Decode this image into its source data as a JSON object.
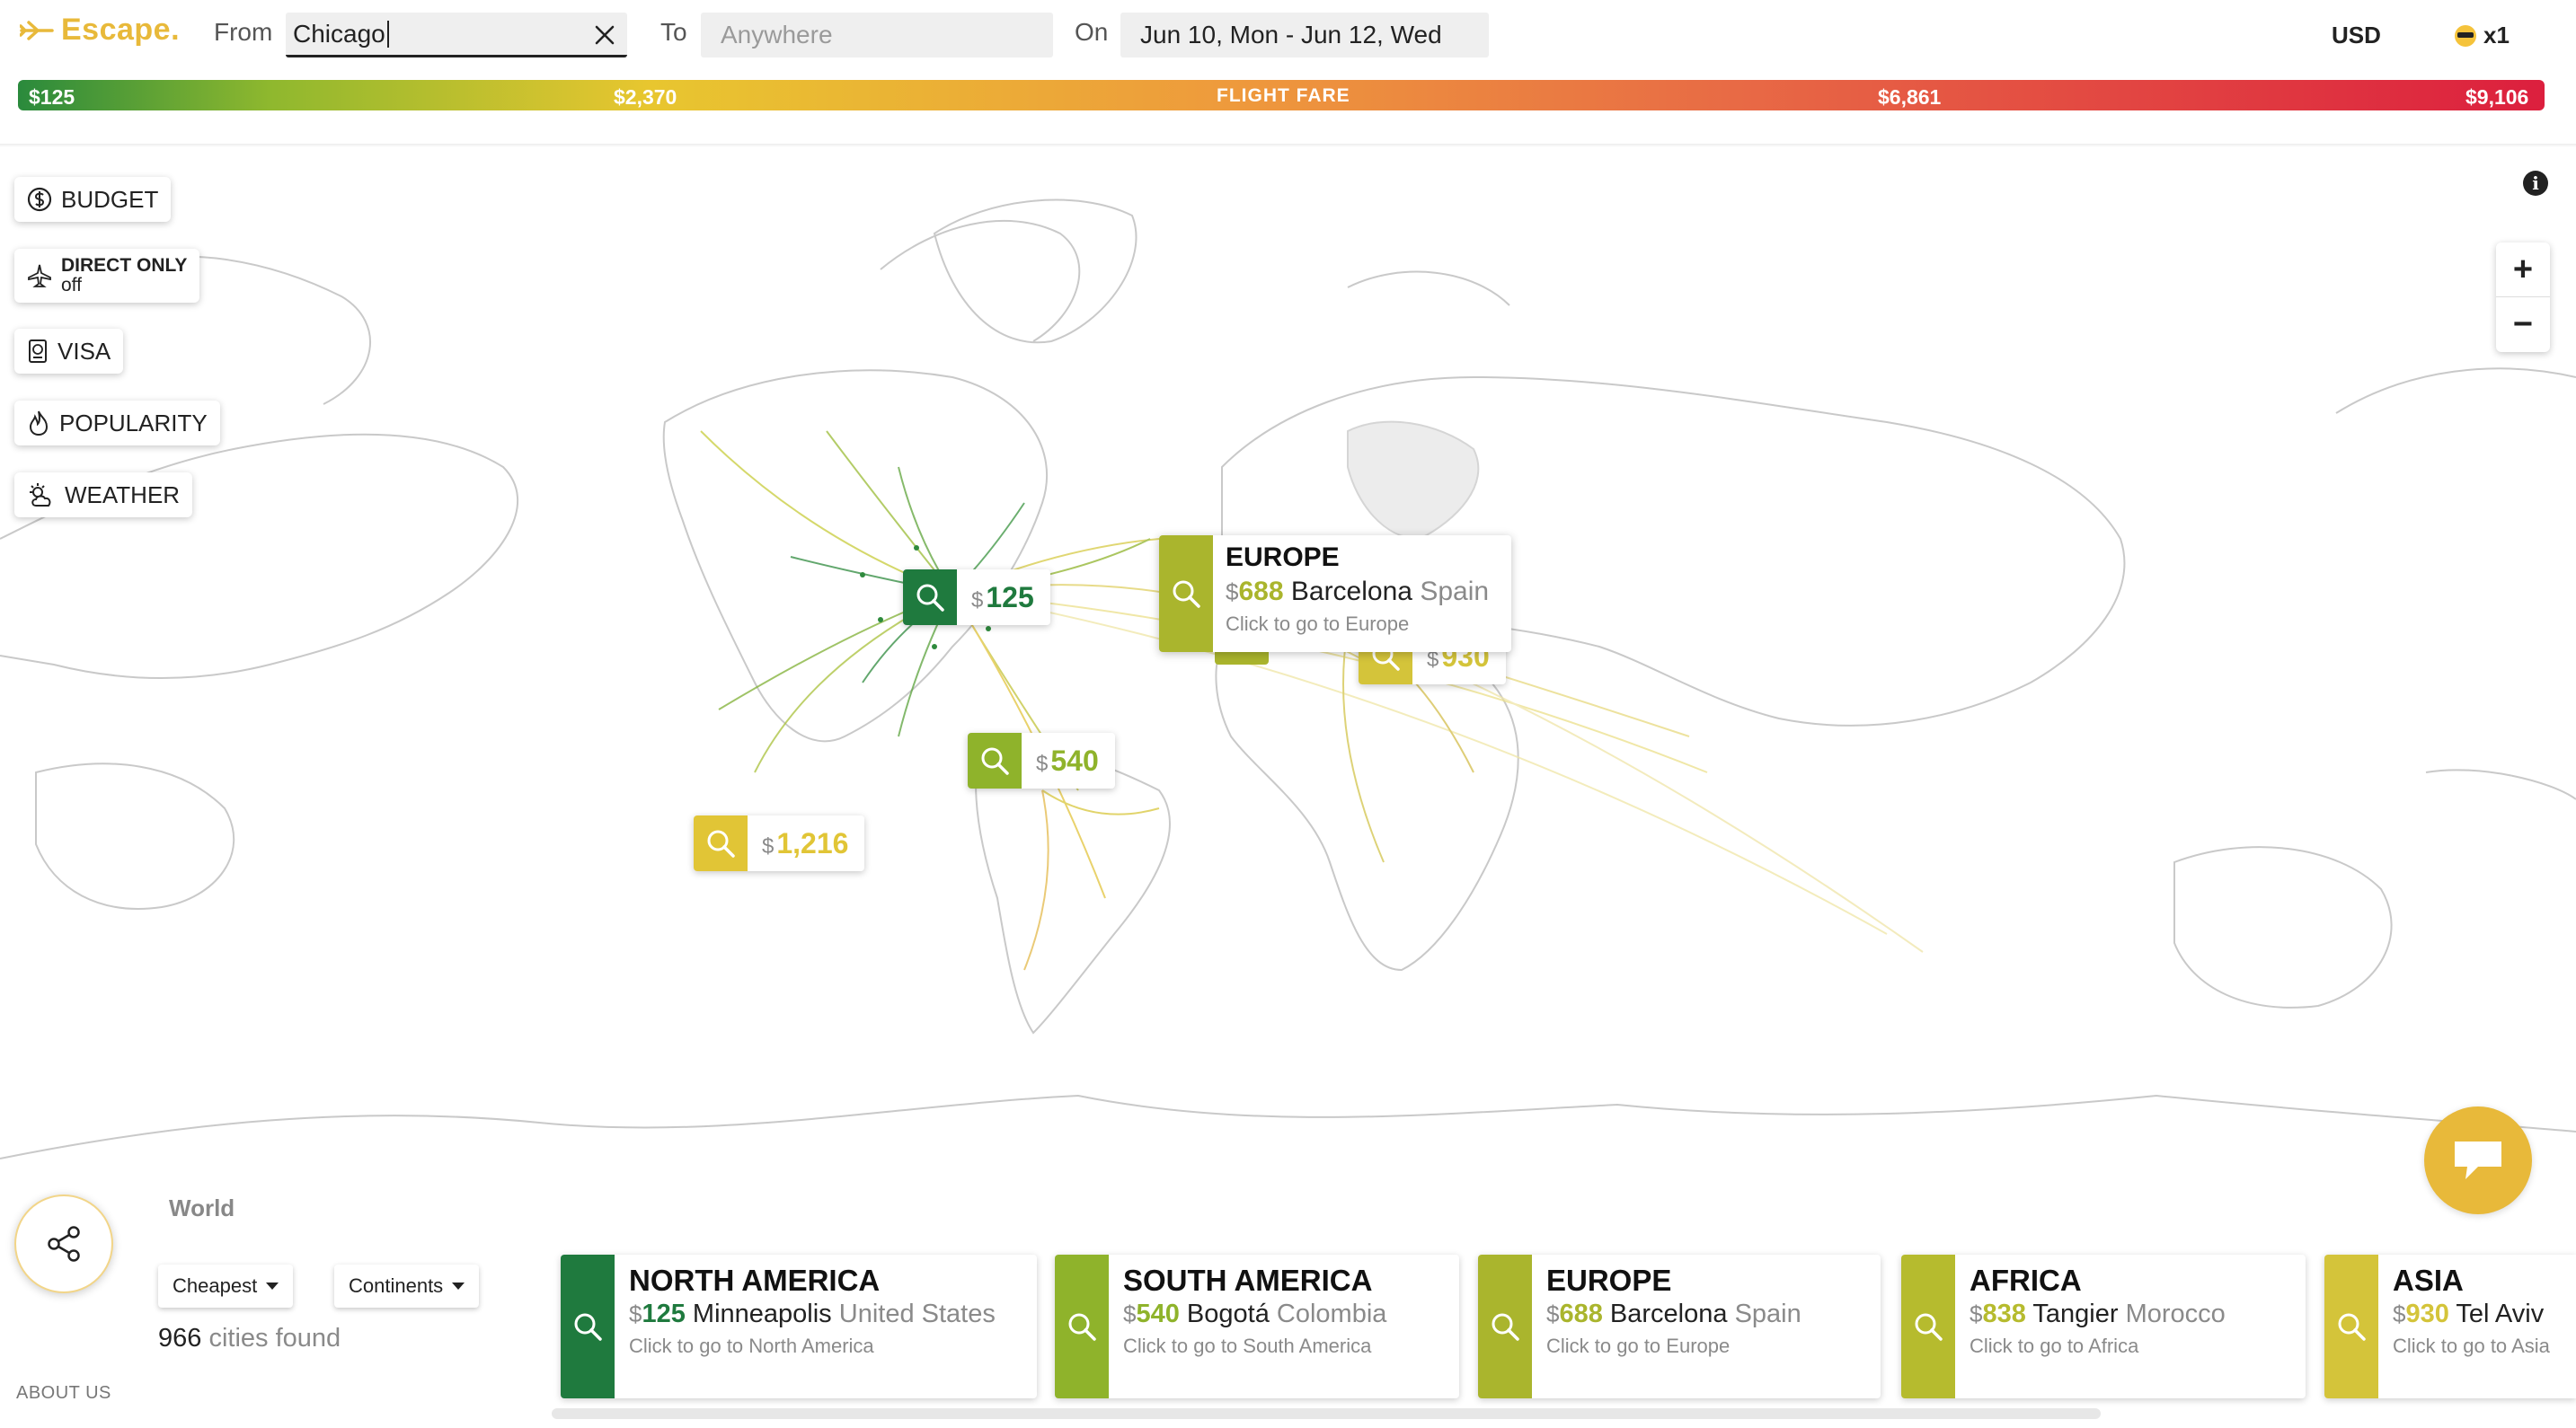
{
  "header": {
    "logo": "Escape.",
    "from_label": "From",
    "from_value": "Chicago",
    "to_label": "To",
    "to_placeholder": "Anywhere",
    "on_label": "On",
    "dates": "Jun 10, Mon - Jun 12, Wed",
    "currency": "USD",
    "travelers": "x1"
  },
  "fare_bar": {
    "title": "FLIGHT FARE",
    "ticks": [
      "$125",
      "$2,370",
      "$6,861",
      "$9,106"
    ]
  },
  "filters": [
    {
      "label": "BUDGET",
      "icon": "dollar-icon"
    },
    {
      "label": "DIRECT ONLY",
      "sub": "off",
      "icon": "plane-icon"
    },
    {
      "label": "VISA",
      "icon": "passport-icon"
    },
    {
      "label": "POPULARITY",
      "icon": "flame-icon"
    },
    {
      "label": "WEATHER",
      "icon": "sun-cloud-icon"
    }
  ],
  "map": {
    "pins": [
      {
        "currency": "$",
        "price": "125",
        "color": "#1f7a3e"
      },
      {
        "currency": "$",
        "price": "540",
        "color": "#8fb32b"
      },
      {
        "currency": "$",
        "price": "1,216",
        "color": "#e1c536"
      },
      {
        "currency": "$",
        "price": "930",
        "color": "#d4c43a"
      }
    ],
    "tooltip": {
      "title": "EUROPE",
      "currency": "$",
      "price": "688",
      "city": "Barcelona",
      "country": "Spain",
      "hint": "Click to go to Europe"
    }
  },
  "bottom": {
    "world_label": "World",
    "sort": "Cheapest",
    "group": "Continents",
    "count": "966",
    "count_suffix": "cities found",
    "about": "ABOUT US"
  },
  "cards": [
    {
      "title": "NORTH AMERICA",
      "currency": "$",
      "price": "125",
      "city": "Minneapolis",
      "country": "United States",
      "hint": "Click to go to North America",
      "color": "#1f7a3e"
    },
    {
      "title": "SOUTH AMERICA",
      "currency": "$",
      "price": "540",
      "city": "Bogotá",
      "country": "Colombia",
      "hint": "Click to go to South America",
      "color": "#8fb32b"
    },
    {
      "title": "EUROPE",
      "currency": "$",
      "price": "688",
      "city": "Barcelona",
      "country": "Spain",
      "hint": "Click to go to Europe",
      "color": "#aab52d"
    },
    {
      "title": "AFRICA",
      "currency": "$",
      "price": "838",
      "city": "Tangier",
      "country": "Morocco",
      "hint": "Click to go to Africa",
      "color": "#b6bb2e"
    },
    {
      "title": "ASIA",
      "currency": "$",
      "price": "930",
      "city": "Tel Aviv",
      "country": "",
      "hint": "Click to go to Asia",
      "color": "#d4c43a"
    }
  ]
}
